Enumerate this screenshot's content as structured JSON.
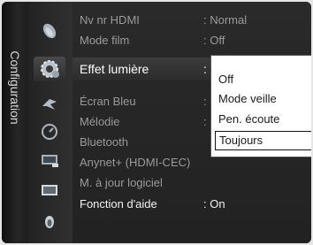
{
  "sidebar": {
    "label": "Configuration"
  },
  "icons": [
    "satellite-dish-icon",
    "settings-gear-icon",
    "chevron-tool-icon",
    "power-gauge-icon",
    "tv-display-icon",
    "monitor-screen-icon",
    "help-bulb-icon"
  ],
  "menu": {
    "items": [
      {
        "label": "Nv nr HDMI",
        "value": ": Normal"
      },
      {
        "label": "Mode film",
        "value": ": Off"
      },
      {
        "label": "Effet lumière",
        "value": ":"
      },
      {
        "label": "Écran Bleu",
        "value": ":"
      },
      {
        "label": "Mélodie",
        "value": ":"
      },
      {
        "label": "Bluetooth",
        "value": ""
      },
      {
        "label": "Anynet+ (HDMI-CEC)",
        "value": ""
      },
      {
        "label": "M. à jour logiciel",
        "value": ""
      },
      {
        "label": "Fonction d'aide",
        "value": ": On"
      }
    ]
  },
  "dropdown": {
    "options": [
      "Off",
      "Mode veille",
      "Pen. écoute",
      "Toujours"
    ],
    "selected": "Toujours"
  },
  "colors": {
    "background": "#1b1b1b",
    "text_dim": "#9a9a9a",
    "text_bright": "#f2f2f2"
  }
}
